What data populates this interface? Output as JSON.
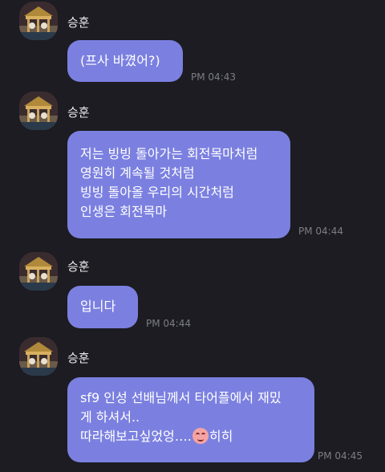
{
  "theme": {
    "background": "#1c1c22",
    "bubble_color": "#7b80e0",
    "bubble_text_color": "#ffffff",
    "sender_color": "#e8e8ec",
    "time_color": "#7d7d85"
  },
  "messages": [
    {
      "sender": "승훈",
      "lines": [
        "(프사 바꼈어?)"
      ],
      "time": "PM 04:43"
    },
    {
      "sender": "승훈",
      "lines": [
        "저는 빙빙 돌아가는 회전목마처럼",
        "영원히 계속될 것처럼",
        "빙빙 돌아올 우리의 시간처럼",
        "인생은 회전목마"
      ],
      "time": "PM 04:44"
    },
    {
      "sender": "승훈",
      "lines": [
        "입니다"
      ],
      "time": "PM 04:44"
    },
    {
      "sender": "승훈",
      "lines": [
        "sf9 인성 선배님께서 타어플에서 재밌",
        "게 하셔서..",
        "따라해보고싶었엉…."
      ],
      "emoji": "smiling-face-emoji",
      "after_emoji": "히히",
      "time": "PM 04:45"
    }
  ]
}
